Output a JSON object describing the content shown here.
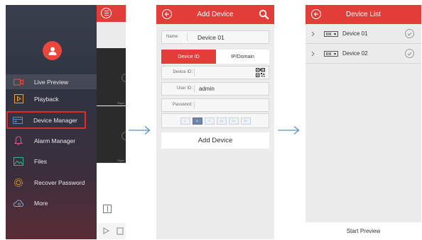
{
  "menu": {
    "items": [
      {
        "label": "Live Preview",
        "icon": "video-camera-icon"
      },
      {
        "label": "Playback",
        "icon": "playback-icon"
      },
      {
        "label": "Device Manager",
        "icon": "device-manager-icon"
      },
      {
        "label": "Alarm Manager",
        "icon": "bell-icon"
      },
      {
        "label": "Files",
        "icon": "image-file-icon"
      },
      {
        "label": "Recover Password",
        "icon": "gear-lock-icon"
      },
      {
        "label": "More",
        "icon": "cloud-gear-icon"
      }
    ],
    "thumbnail_label": "Player"
  },
  "add_device": {
    "title": "Add Device",
    "name_label": "Name:",
    "name_value": "Device 01",
    "tabs": [
      "Device ID",
      "IP/Domain"
    ],
    "device_id_label": "Device ID:",
    "user_id_label": "User ID:",
    "user_id_value": "admin",
    "password_label": "Password:",
    "keypad_keys": [
      "1",
      "4",
      "9",
      "16",
      "24",
      "32"
    ],
    "keypad_selected": "4",
    "submit_label": "Add Device"
  },
  "device_list": {
    "title": "Device List",
    "devices": [
      "Device 01",
      "Device 02"
    ],
    "start_preview_label": "Start Preview"
  },
  "colors": {
    "accent_red": "#e33d3a",
    "highlight_box": "#d92c2c",
    "arrow_blue": "#5b8fc7"
  }
}
